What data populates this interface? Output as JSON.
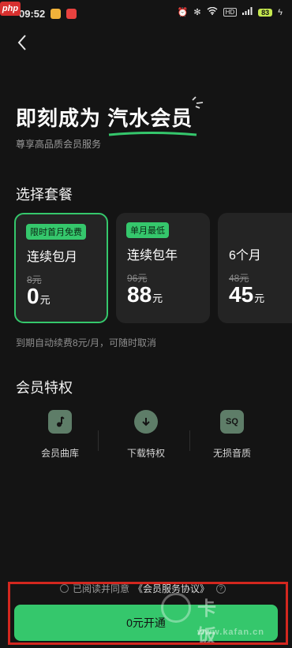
{
  "status_bar": {
    "watermark_logo": "php",
    "time": "09:52",
    "network_badge": "HD",
    "battery": "83"
  },
  "hero": {
    "title_prefix": "即刻成为",
    "title_highlight": "汽水会员",
    "subtitle": "尊享高品质会员服务"
  },
  "plans_section": {
    "title": "选择套餐",
    "plans": [
      {
        "tag": "限时首月免费",
        "name": "连续包月",
        "original_price": "8元",
        "price": "0",
        "unit": "元",
        "selected": true
      },
      {
        "tag": "单月最低",
        "name": "连续包年",
        "original_price": "96元",
        "price": "88",
        "unit": "元",
        "selected": false
      },
      {
        "tag": "",
        "name": "6个月",
        "original_price": "48元",
        "price": "45",
        "unit": "元",
        "selected": false
      }
    ],
    "renew_note": "到期自动续费8元/月，可随时取消"
  },
  "perks_section": {
    "title": "会员特权",
    "items": [
      {
        "label": "会员曲库",
        "icon": "music-note-icon"
      },
      {
        "label": "下载特权",
        "icon": "download-icon"
      },
      {
        "label": "无损音质",
        "icon": "sq-quality-icon",
        "icon_text": "SQ"
      }
    ]
  },
  "agreement": {
    "prefix": "已阅读并同意",
    "link": "《会员服务协议》",
    "help_text": "?"
  },
  "cta": {
    "label": "0元开通"
  },
  "watermark": {
    "brand": "卡饭网",
    "url": "www.kafan.cn"
  },
  "colors": {
    "background": "#141414",
    "accent": "#35c76c",
    "card": "#242424",
    "highlight_box": "#d3271f"
  }
}
